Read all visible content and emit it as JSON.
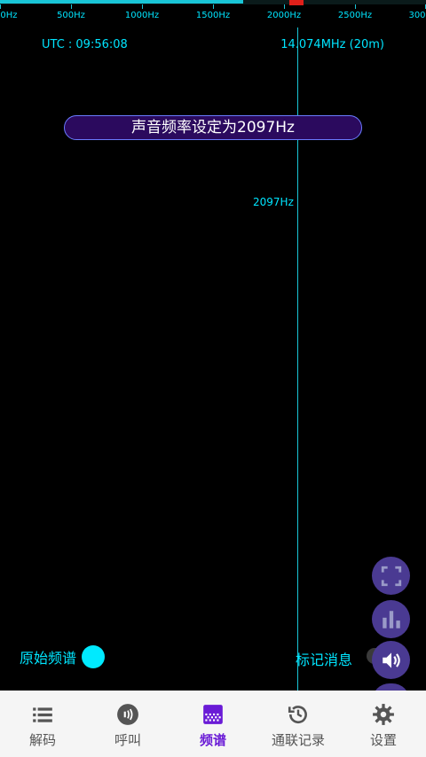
{
  "status": {
    "utc": "UTC : 09:56:08",
    "frequency": "14.074MHz (20m)"
  },
  "ruler": {
    "labels": [
      "0Hz",
      "500Hz",
      "1000Hz",
      "1500Hz",
      "2000Hz",
      "2500Hz",
      "300"
    ]
  },
  "spectrum": {
    "cursor_label": "2097Hz",
    "progress_fraction": 0.57
  },
  "toast": {
    "message": "声音频率设定为2097Hz"
  },
  "controls": {
    "raw_spectrum_label": "原始频谱",
    "mark_message_label": "标记消息"
  },
  "fabs": [
    "fullscreen-icon",
    "bar-chart-icon",
    "speaker-icon"
  ],
  "nav": {
    "items": [
      {
        "label": "解码",
        "icon": "list-icon"
      },
      {
        "label": "呼叫",
        "icon": "call-icon"
      },
      {
        "label": "频谱",
        "icon": "spectrum-icon",
        "active": true
      },
      {
        "label": "通联记录",
        "icon": "history-icon"
      },
      {
        "label": "设置",
        "icon": "gear-icon"
      }
    ]
  },
  "colors": {
    "accent": "#00e5ff",
    "toast_bg": "#2b0a5e",
    "nav_active": "#6a1bd6",
    "fab_bg": "#4a3a92",
    "marker": "#e0201a"
  }
}
